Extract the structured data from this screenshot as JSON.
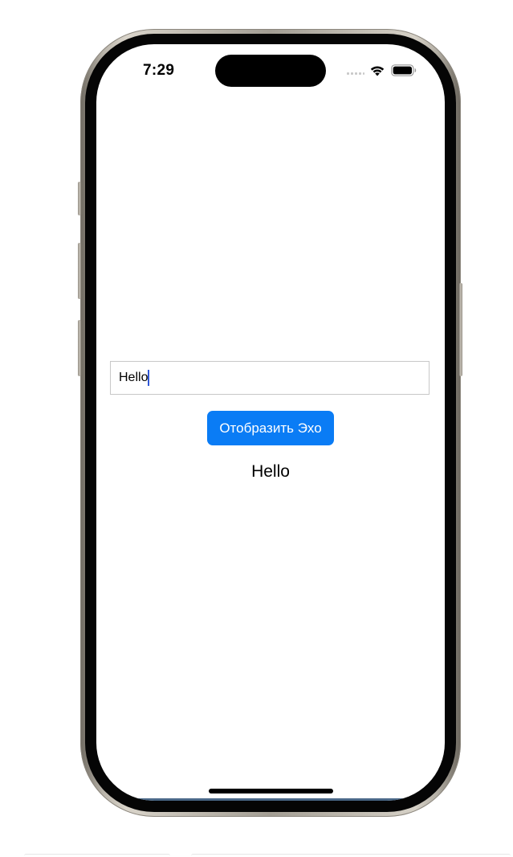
{
  "status_bar": {
    "time": "7:29",
    "icons": [
      "cellular-signal-icon",
      "wifi-icon",
      "battery-icon"
    ]
  },
  "input": {
    "value": "Hello"
  },
  "button": {
    "label": "Отобразить Эхо"
  },
  "output": {
    "text": "Hello"
  },
  "colors": {
    "button_background": "#0a7cf5",
    "caret": "#2f56d6",
    "input_border": "#c8c8c8"
  }
}
